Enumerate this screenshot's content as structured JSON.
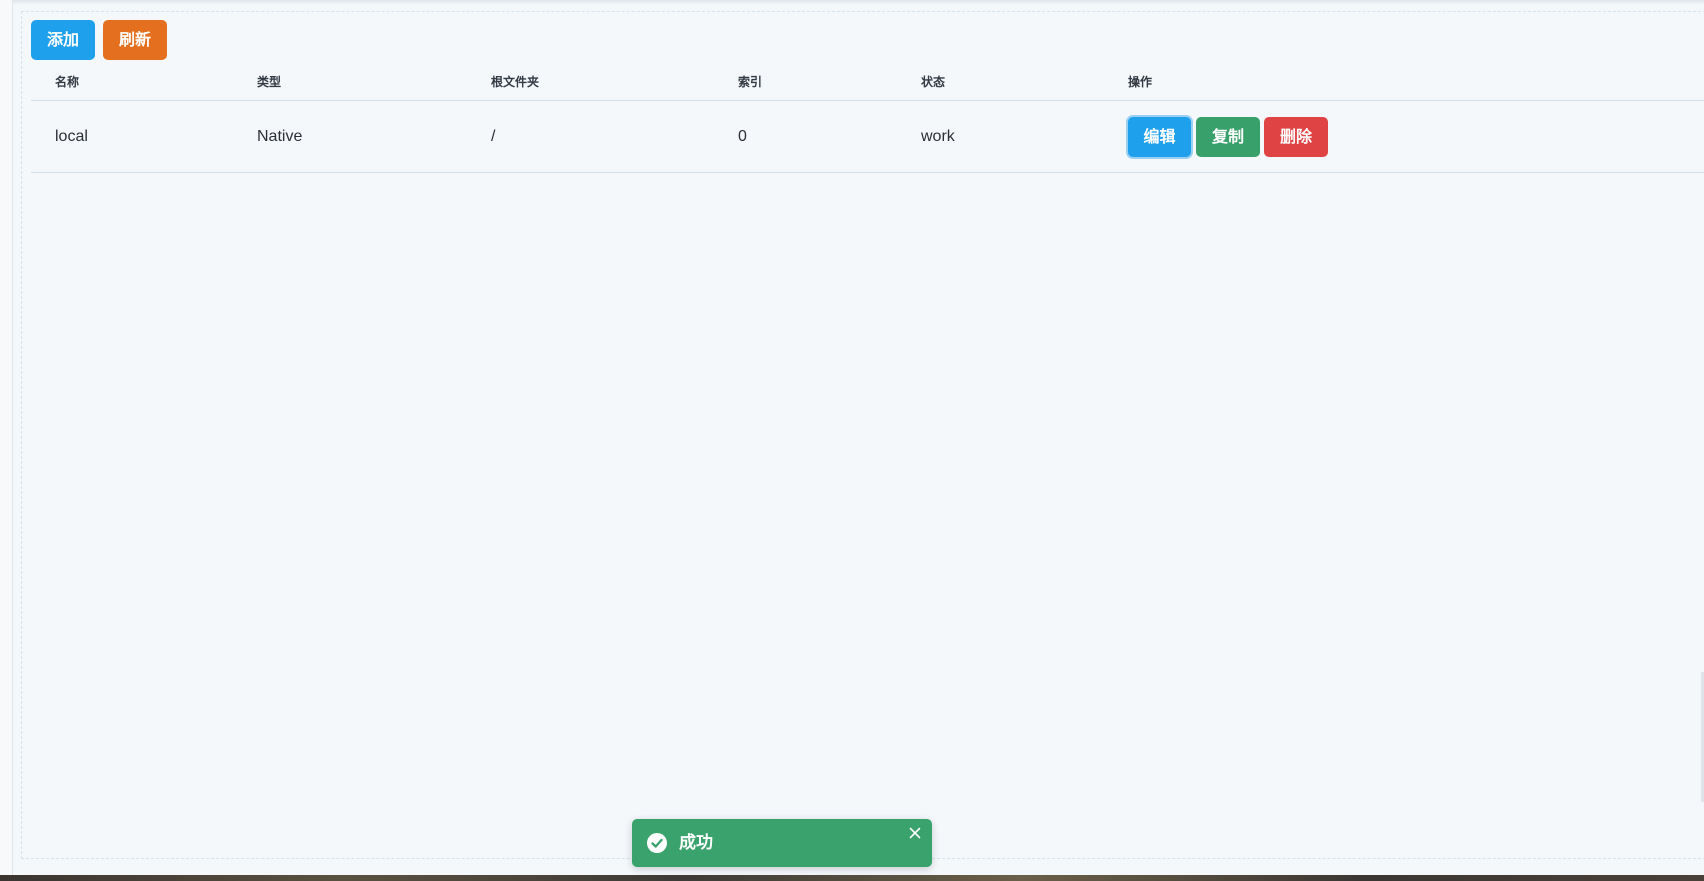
{
  "toolbar": {
    "add_label": "添加",
    "refresh_label": "刷新"
  },
  "table": {
    "columns": [
      "名称",
      "类型",
      "根文件夹",
      "索引",
      "状态",
      "操作"
    ],
    "rows": [
      {
        "name": "local",
        "type": "Native",
        "root_folder": "/",
        "index": "0",
        "status": "work",
        "actions": {
          "edit_label": "编辑",
          "copy_label": "复制",
          "delete_label": "删除"
        }
      }
    ]
  },
  "toast": {
    "message": "成功",
    "icon": "check-circle-icon",
    "close_icon": "close-icon"
  },
  "colors": {
    "primary": "#1ea0ec",
    "warning": "#e4701f",
    "success": "#38a06a",
    "danger": "#e04343",
    "toast_success": "#3aa36d",
    "background": "#f4f8fb"
  }
}
